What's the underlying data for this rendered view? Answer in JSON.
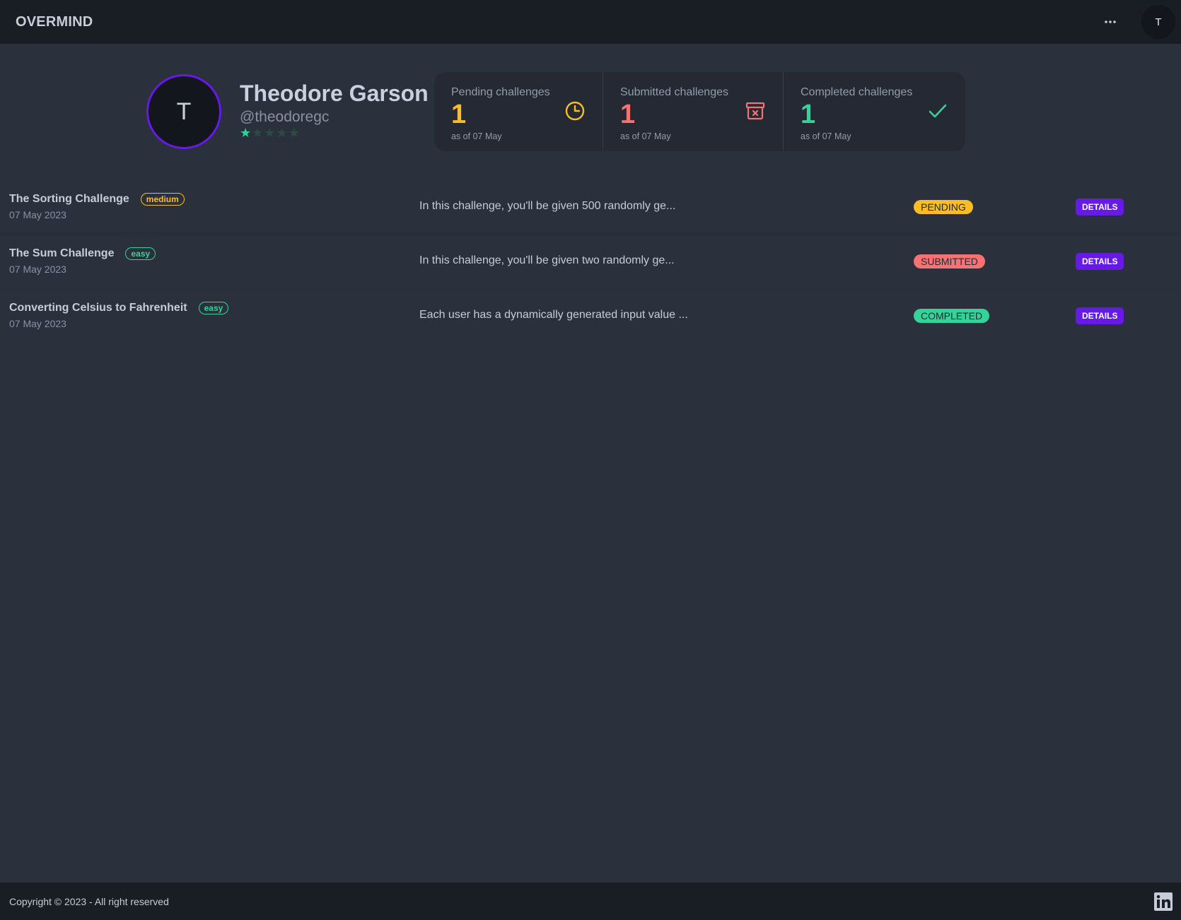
{
  "navbar": {
    "brand": "OVERMIND",
    "menu_icon": "more-horizontal-icon",
    "avatar_initial": "T"
  },
  "profile": {
    "initial": "T",
    "name": "Theodore Garson",
    "handle": "@theodoregc",
    "rating": 1,
    "rating_max": 5
  },
  "stats": [
    {
      "title": "Pending challenges",
      "value": "1",
      "desc": "as of 07 May",
      "color": "#fbbd23",
      "icon": "clock-icon"
    },
    {
      "title": "Submitted challenges",
      "value": "1",
      "desc": "as of 07 May",
      "color": "#f87272",
      "icon": "archive-x-icon"
    },
    {
      "title": "Completed challenges",
      "value": "1",
      "desc": "as of 07 May",
      "color": "#36d399",
      "icon": "check-icon"
    }
  ],
  "challenges": [
    {
      "title": "The Sorting Challenge",
      "difficulty": "medium",
      "date": "07 May 2023",
      "description": "In this challenge, you'll be given 500 randomly ge...",
      "status": "PENDING",
      "status_color": "#fbbd23",
      "action": "DETAILS"
    },
    {
      "title": "The Sum Challenge",
      "difficulty": "easy",
      "date": "07 May 2023",
      "description": "In this challenge, you'll be given two randomly ge...",
      "status": "SUBMITTED",
      "status_color": "#f87272",
      "action": "DETAILS"
    },
    {
      "title": "Converting Celsius to Fahrenheit",
      "difficulty": "easy",
      "date": "07 May 2023",
      "description": "Each user has a dynamically generated input value ...",
      "status": "COMPLETED",
      "status_color": "#36d399",
      "action": "DETAILS"
    }
  ],
  "footer": {
    "copyright": "Copyright © 2023 - All right reserved",
    "social_icon": "linkedin-icon"
  },
  "colors": {
    "primary": "#661ae6",
    "background": "#2a303c",
    "navbar": "#191d24"
  }
}
